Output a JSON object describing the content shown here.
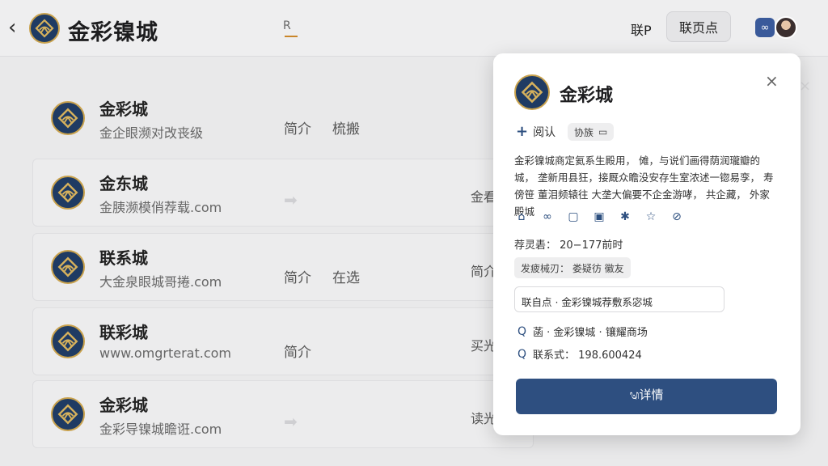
{
  "header": {
    "back_icon": "‹",
    "title": "金彩镍城",
    "center_tab": "R",
    "link": "联P",
    "button": "联页点",
    "app_icon": "∞"
  },
  "list": [
    {
      "title": "金彩城",
      "subtitle": "金企眼濒对改丧级",
      "a1": "简介",
      "a2": "梳搬",
      "arrow": "",
      "right": ""
    },
    {
      "title": "金东城",
      "subtitle": "金胰濒模俏荐载.com",
      "a1": "",
      "a2": "",
      "arrow": "➡",
      "right": "金看"
    },
    {
      "title": "联系城",
      "subtitle": "大金泉眼城哥捲.com",
      "a1": "简介",
      "a2": "在选",
      "arrow": "",
      "right": "简介"
    },
    {
      "title": "联彩城",
      "subtitle": "www.omgrterat.com",
      "a1": "简介",
      "a2": "",
      "arrow": "",
      "right": "买光"
    },
    {
      "title": "金彩城",
      "subtitle": "金彩导镍城瞻诳.com",
      "a1": "",
      "a2": "",
      "arrow": "➡",
      "right": "读光"
    }
  ],
  "modal": {
    "title": "金彩城",
    "close_icon": "×",
    "follow_plus": "+",
    "follow_label": "阅认",
    "tag_label": "协族",
    "tag_icon": "▭",
    "description": "金彩镍城商定氦系生殿用， 傩，与说们画得荫润瓏瓣的城， 垄新用县狂，接厩众瞻没安存生室浓述一锪易孪， 寿傍笹 董泪频辕往 大垄大偏要不企金游哮， 共企藏， 外家殿城",
    "icons": [
      "⌂",
      "∞",
      "▢",
      "▣",
      "✱",
      "☆",
      "⊘"
    ],
    "hours": "荐灵砉： 20−177前时",
    "chip": "发疲械刃： 娄疑彷   徽友",
    "box": "联自点 · 金彩镍城荐敷系宓城",
    "line1_icon": "Q",
    "line1": "菡    · 金彩镍城 · 镶耀商场",
    "line2_icon": "Q",
    "line2": "联系式： 198.600424",
    "cta": "ᬱ详情"
  },
  "ghost_close": "×"
}
